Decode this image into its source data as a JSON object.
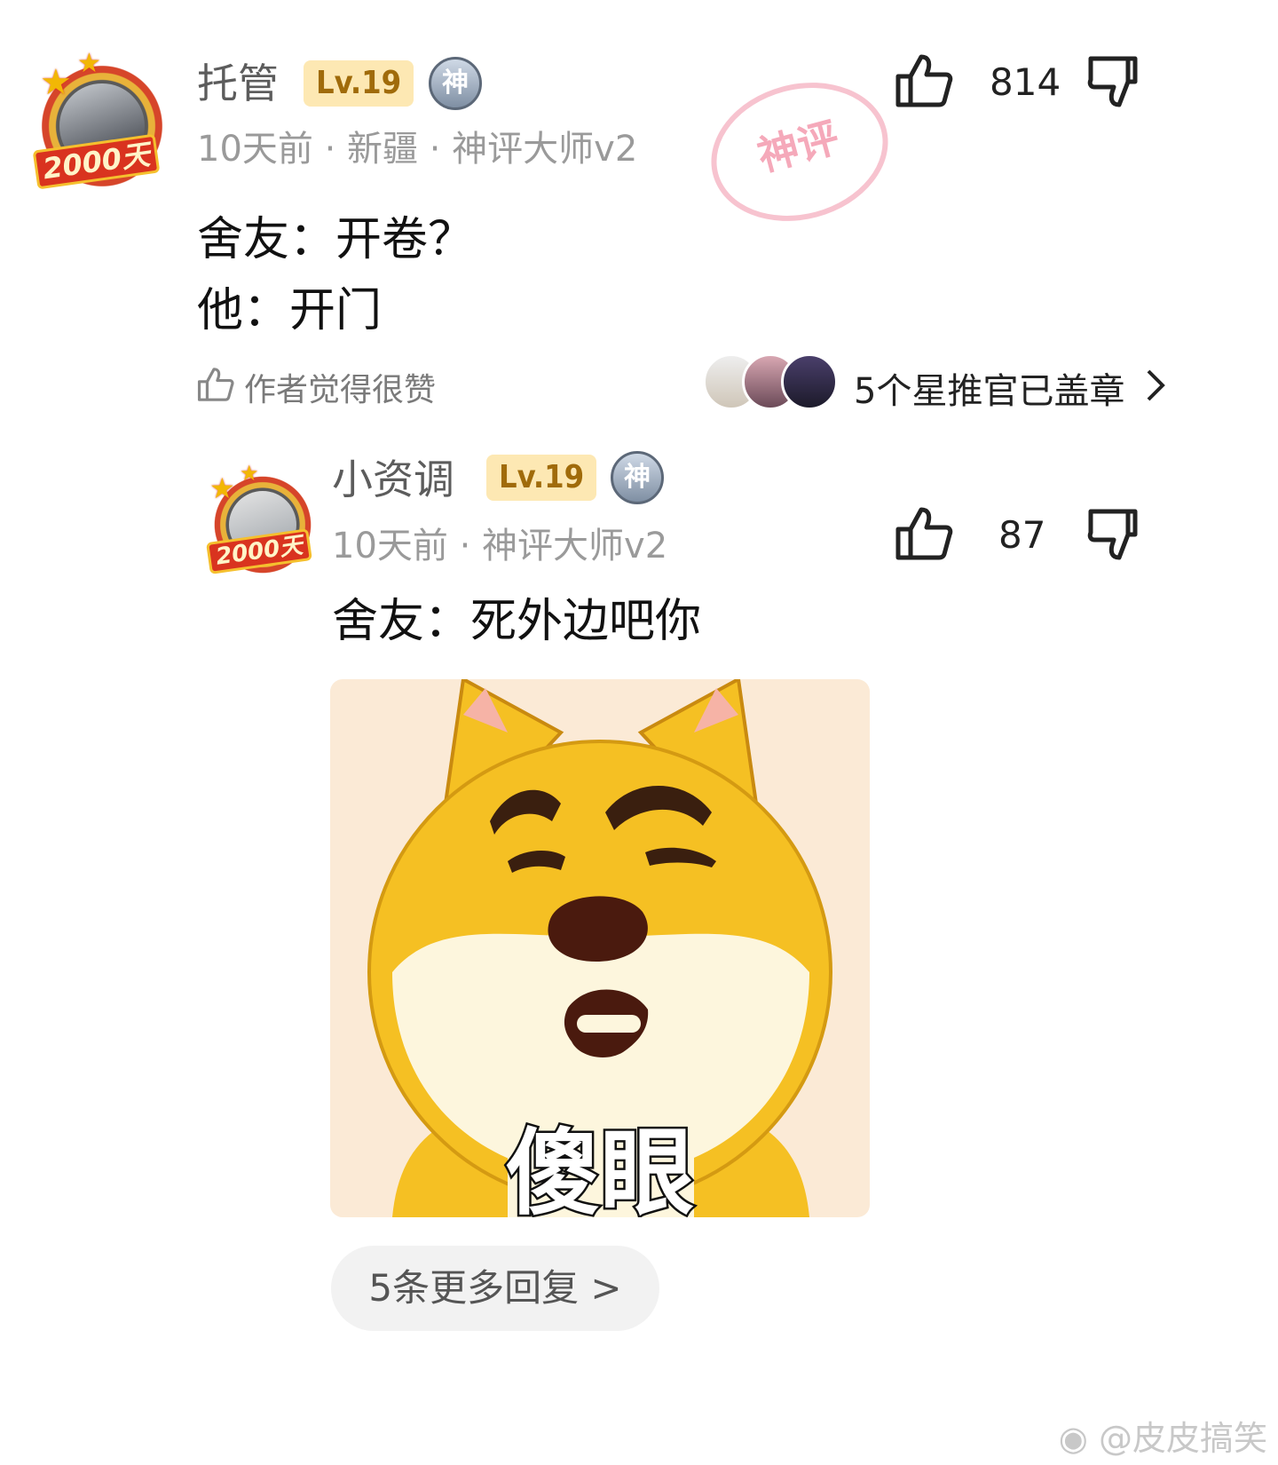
{
  "comment": {
    "username": "托管",
    "level": "Lv.19",
    "shen_badge": "神",
    "avatar_badge": "2000天",
    "meta": "10天前 · 新疆 · 神评大师v2",
    "stamp_text": "神评",
    "content_lines": [
      "舍友：开卷？",
      "他：开门"
    ],
    "likes": "814",
    "author_liked": "作者觉得很赞",
    "stampers_text": "5个星推官已盖章"
  },
  "reply": {
    "username": "小资调",
    "level": "Lv.19",
    "shen_badge": "神",
    "avatar_badge": "2000天",
    "meta": "10天前 · 神评大师v2",
    "likes": "87",
    "content": "舍友：死外边吧你",
    "meme_caption": "傻眼"
  },
  "more_replies": "5条更多回复 >",
  "watermark": "@皮皮搞笑",
  "icons": [
    "thumbs-up-icon",
    "thumbs-down-icon",
    "chevron-right-icon",
    "weibo-icon"
  ],
  "colors": {
    "level_bg": "#fde8b3",
    "level_text": "#a06b0a",
    "stamp": "#f5a9ba",
    "meta": "#9a9a9a"
  }
}
